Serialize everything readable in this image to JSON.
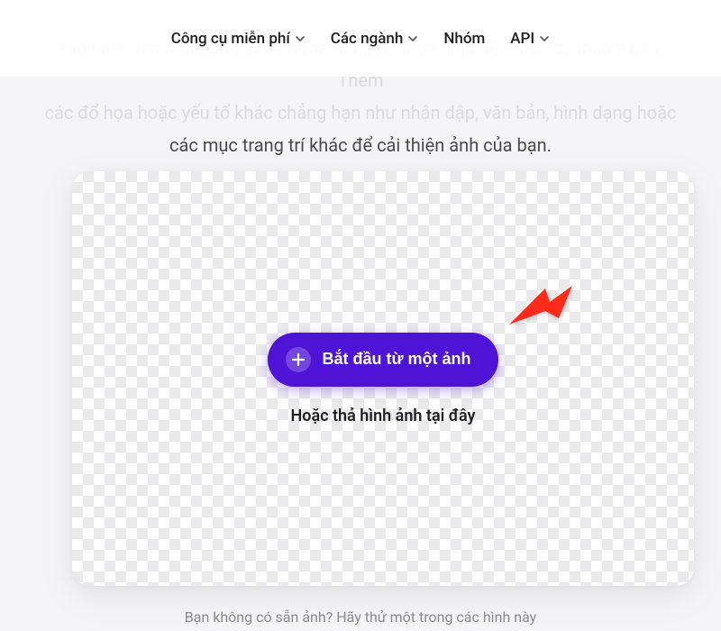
{
  "nav": {
    "items": [
      {
        "label": "Công cụ miễn phí",
        "hasDropdown": true
      },
      {
        "label": "Các ngành",
        "hasDropdown": true
      },
      {
        "label": "Nhóm",
        "hasDropdown": false
      },
      {
        "label": "API",
        "hasDropdown": true
      }
    ]
  },
  "hero": {
    "line1_faded": "Tạo hình nền mới bằng công nghệ AI hoặc chọn hình nền hiện có theo ý bạn. Thêm",
    "line2_faded": "các đổ họa hoặc yếu tố khác chẳng hạn như nhân dập, văn bản, hình dạng hoặc",
    "line3_visible": "các mục trang trí khác để cải thiện ảnh của bạn."
  },
  "upload": {
    "button_label": "Bắt đầu từ một ảnh",
    "drop_label": "Hoặc thả hình ảnh tại đây"
  },
  "footer": {
    "prompt": "Bạn không có sẵn ảnh? Hãy thử một trong các hình này"
  },
  "colors": {
    "accent": "#4f13d6",
    "arrow": "#ff2a1a"
  }
}
